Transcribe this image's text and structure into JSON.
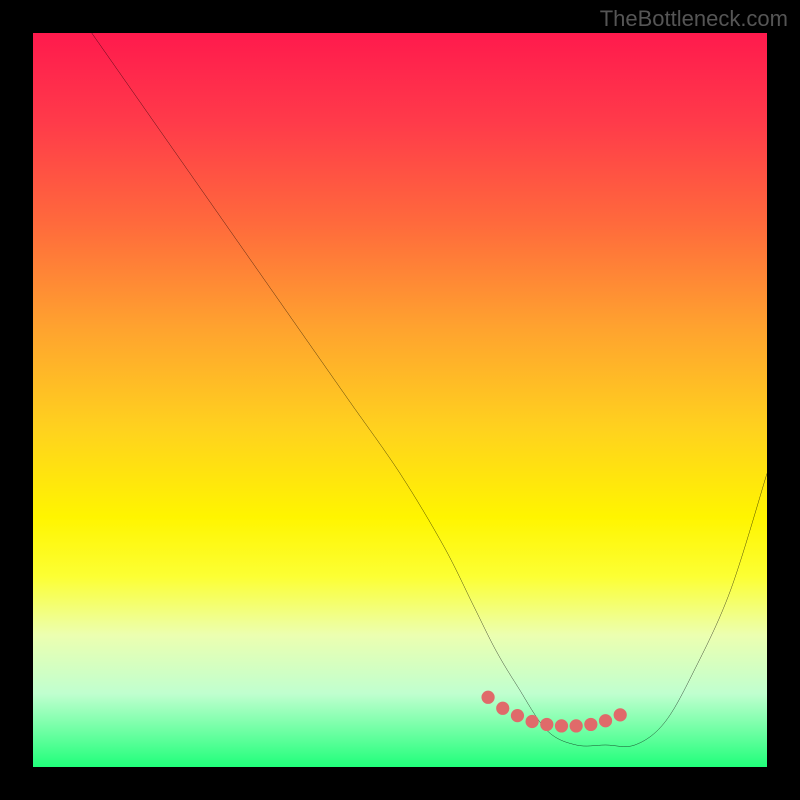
{
  "watermark": "TheBottleneck.com",
  "chart_data": {
    "type": "line",
    "title": "",
    "xlabel": "",
    "ylabel": "",
    "xlim": [
      0,
      100
    ],
    "ylim": [
      0,
      100
    ],
    "grid": false,
    "series": [
      {
        "name": "bottleneck-curve",
        "color": "#000000",
        "x": [
          8,
          15,
          22,
          29,
          36,
          43,
          50,
          56,
          60,
          63,
          66,
          70,
          74,
          78,
          82,
          86,
          90,
          95,
          100
        ],
        "values": [
          100,
          90,
          80,
          70,
          60,
          50,
          40,
          30,
          22,
          16,
          11,
          5,
          3,
          3,
          3,
          6,
          13,
          24,
          40
        ]
      }
    ],
    "markers": {
      "name": "highlight-dots",
      "color": "#e06a6a",
      "x": [
        62,
        64,
        66,
        68,
        70,
        72,
        74,
        76,
        78,
        80
      ],
      "values": [
        9.5,
        8.0,
        7.0,
        6.2,
        5.8,
        5.6,
        5.6,
        5.8,
        6.3,
        7.1
      ]
    },
    "gradient_stops": [
      {
        "pos": 0,
        "color": "#ff1a4d"
      },
      {
        "pos": 12,
        "color": "#ff3a4a"
      },
      {
        "pos": 26,
        "color": "#ff6a3c"
      },
      {
        "pos": 40,
        "color": "#ffa22f"
      },
      {
        "pos": 54,
        "color": "#ffd21e"
      },
      {
        "pos": 66,
        "color": "#fff500"
      },
      {
        "pos": 74,
        "color": "#fcff33"
      },
      {
        "pos": 82,
        "color": "#ecffb0"
      },
      {
        "pos": 90,
        "color": "#c0ffcf"
      },
      {
        "pos": 100,
        "color": "#20ff7a"
      }
    ]
  }
}
